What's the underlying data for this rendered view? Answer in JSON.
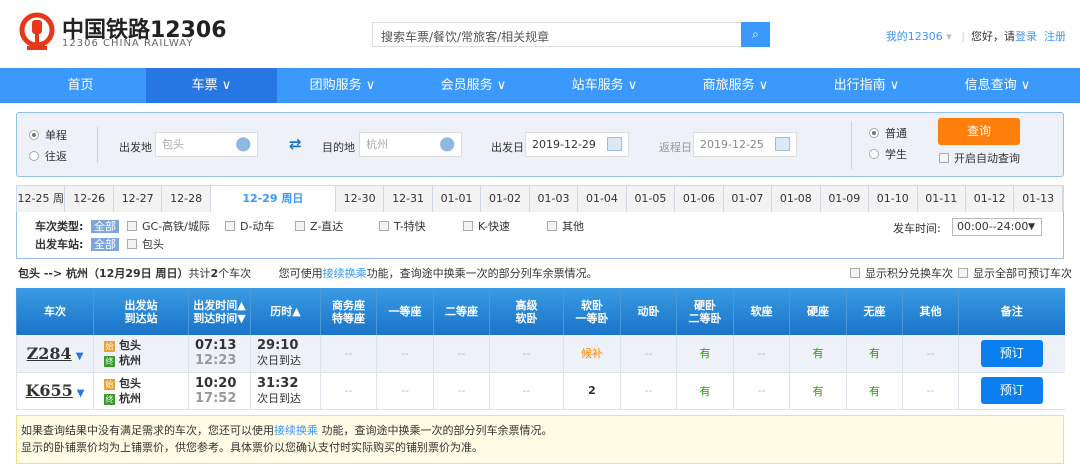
{
  "header": {
    "brand": "中国铁路12306",
    "brand_en": "12306 CHINA RAILWAY",
    "search_placeholder": "搜索车票/餐饮/常旅客/相关规章",
    "my12306": "我的12306",
    "greeting": "您好，请",
    "login": "登录",
    "register": "注册"
  },
  "nav": [
    {
      "label": "首页"
    },
    {
      "label": "车票 ∨"
    },
    {
      "label": "团购服务 ∨"
    },
    {
      "label": "会员服务 ∨"
    },
    {
      "label": "站车服务 ∨"
    },
    {
      "label": "商旅服务 ∨"
    },
    {
      "label": "出行指南 ∨"
    },
    {
      "label": "信息查询 ∨"
    }
  ],
  "form": {
    "one_way": "单程",
    "round_trip": "往返",
    "from_label": "出发地",
    "from_value": "包头",
    "to_label": "目的地",
    "to_value": "杭州",
    "depart_label": "出发日",
    "depart_value": "2019-12-29",
    "return_label": "返程日",
    "return_value": "2019-12-25",
    "adult": "普通",
    "student": "学生",
    "query": "查询",
    "auto_query": "开启自动查询"
  },
  "dates": [
    "12-25 周",
    "12-26",
    "12-27",
    "12-28",
    "12-29 周日",
    "12-30",
    "12-31",
    "01-01",
    "01-02",
    "01-03",
    "01-04",
    "01-05",
    "01-06",
    "01-07",
    "01-08",
    "01-09",
    "01-10",
    "01-11",
    "01-12",
    "01-13"
  ],
  "filter": {
    "type_label": "车次类型:",
    "all": "全部",
    "types": [
      "GC-高铁/城际",
      "D-动车",
      "Z-直达",
      "T-特快",
      "K-快速",
      "其他"
    ],
    "station_label": "出发车站:",
    "stations": [
      "包头"
    ],
    "time_label": "发车时间:",
    "time_value": "00:00--24:00"
  },
  "summary": {
    "route": "包头 --> 杭州（12月29日  周日）",
    "count_pre": "共计",
    "count": "2",
    "count_post": "个车次",
    "tip_pre": "您可使用",
    "tip_link": "接续换乘",
    "tip_post": "功能，查询途中换乘一次的部分列车余票情况。",
    "opt1": "显示积分兑换车次",
    "opt2": "显示全部可预订车次"
  },
  "table": {
    "headers": [
      "车次",
      "出发站\n到达站",
      "出发时间▲\n到达时间▼",
      "历时▲",
      "商务座\n特等座",
      "一等座",
      "二等座",
      "高级\n软卧",
      "软卧\n一等卧",
      "动卧",
      "硬卧\n二等卧",
      "软座",
      "硬座",
      "无座",
      "其他",
      "备注"
    ],
    "start_tag": "始",
    "end_tag": "终",
    "book": "预订",
    "rows": [
      {
        "train": "Z284",
        "from": "包头",
        "to": "杭州",
        "dep": "07:13",
        "arr": "12:23",
        "dur": "29:10",
        "note": "次日到达",
        "seats": [
          "--",
          "--",
          "--",
          "--",
          "候补",
          "--",
          "有",
          "--",
          "有",
          "有",
          "--"
        ]
      },
      {
        "train": "K655",
        "from": "包头",
        "to": "杭州",
        "dep": "10:20",
        "arr": "17:52",
        "dur": "31:32",
        "note": "次日到达",
        "seats": [
          "--",
          "--",
          "--",
          "--",
          "2",
          "--",
          "有",
          "--",
          "有",
          "有",
          "--"
        ]
      }
    ]
  },
  "notice": {
    "line1_pre": "如果查询结果中没有满足需求的车次，您还可以使用",
    "line1_link": "接续换乘",
    "line1_post": " 功能，查询途中换乘一次的部分列车余票情况。",
    "line2": "显示的卧铺票价均为上铺票价，供您参考。具体票价以您确认支付时实际购买的铺别票价为准。"
  }
}
